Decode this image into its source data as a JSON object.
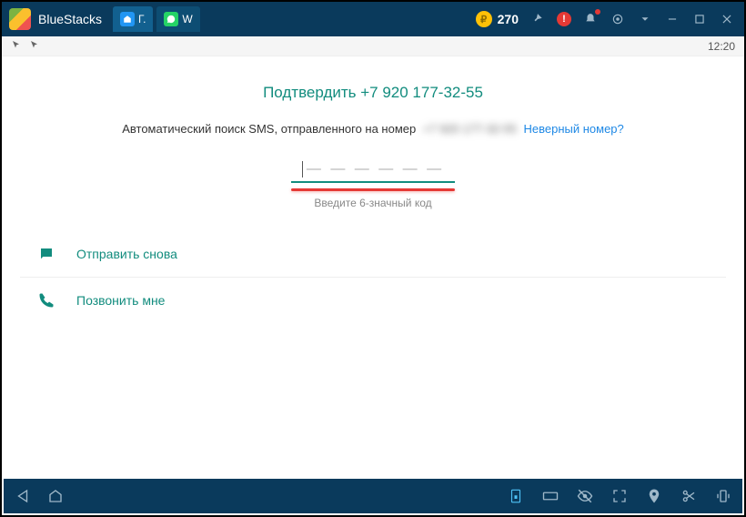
{
  "titlebar": {
    "app_name": "BlueStacks",
    "tabs": [
      {
        "label": "Г."
      },
      {
        "label": "W"
      }
    ],
    "coins": "270"
  },
  "statusbar": {
    "time": "12:20"
  },
  "verify": {
    "title": "Подтвердить +7 920 177-32-55",
    "sms_prefix": "Автоматический поиск SMS, отправленного на номер",
    "masked_number": "+7 920 177-32-55",
    "wrong_number": "Неверный номер?",
    "dashes": "— — —   — — —",
    "hint": "Введите 6-значный код",
    "resend": "Отправить снова",
    "call_me": "Позвонить мне"
  }
}
